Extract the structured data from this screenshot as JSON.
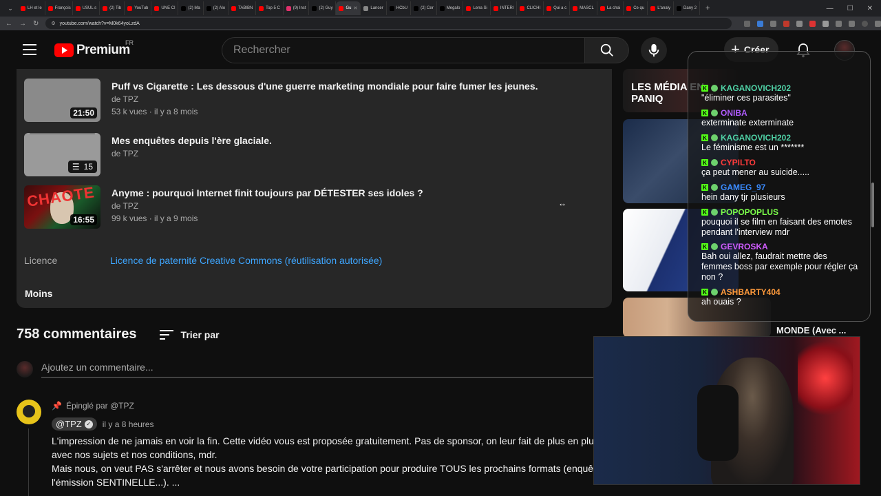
{
  "browser": {
    "tabs": [
      {
        "label": "LH et le",
        "color": "#ff0000"
      },
      {
        "label": "François",
        "color": "#ff0000"
      },
      {
        "label": "USUL s",
        "color": "#ff0000"
      },
      {
        "label": "(2) Tib",
        "color": "#ff0000"
      },
      {
        "label": "YouTub",
        "color": "#ff0000"
      },
      {
        "label": "UNE Cl",
        "color": "#ff0000"
      },
      {
        "label": "(2) Ma",
        "color": "#000000"
      },
      {
        "label": "(2) Alo",
        "color": "#000000"
      },
      {
        "label": "TABIBN",
        "color": "#ff0000"
      },
      {
        "label": "Top 5 C",
        "color": "#ff0000"
      },
      {
        "label": "(9) Inst",
        "color": "#e1306c"
      },
      {
        "label": "(2) Guy",
        "color": "#000000"
      },
      {
        "label": "Gu",
        "color": "#ff0000",
        "active": true
      },
      {
        "label": "Lancer",
        "color": "#888888"
      },
      {
        "label": "HCbU",
        "color": "#000000"
      },
      {
        "label": "(2) Cer",
        "color": "#000000"
      },
      {
        "label": "Megalo",
        "color": "#000000"
      },
      {
        "label": "Lena Si",
        "color": "#ff0000"
      },
      {
        "label": "INTERI",
        "color": "#ff0000"
      },
      {
        "label": "CLICHI",
        "color": "#ff0000"
      },
      {
        "label": "Qui a c",
        "color": "#ff0000"
      },
      {
        "label": "MASCL",
        "color": "#ff0000"
      },
      {
        "label": "La chai",
        "color": "#ff0000"
      },
      {
        "label": "Ce qu",
        "color": "#ff0000"
      },
      {
        "label": "L'analy",
        "color": "#ff0000"
      },
      {
        "label": "Dany 2",
        "color": "#000000"
      }
    ],
    "url": "youtube.com/watch?v=M0k64yoLzdA"
  },
  "header": {
    "logo_text": "Premium",
    "country": "FR",
    "search_placeholder": "Rechercher",
    "create_label": "Créer"
  },
  "description": {
    "videos": [
      {
        "title": "Puff vs Cigarette : Les dessous d'une guerre marketing mondiale pour faire fumer les jeunes.",
        "channel": "de TPZ",
        "stats": "53 k vues · il y a 8 mois",
        "duration": "21:50"
      },
      {
        "title": "Mes enquêtes depuis l'ère glaciale.",
        "channel": "de TPZ",
        "playlist_count": "15"
      },
      {
        "title": "Anyme : pourquoi Internet finit toujours par DÉTESTER ses idoles ?",
        "channel": "de TPZ",
        "stats": "99 k vues · il y a 9 mois",
        "duration": "16:55",
        "thumb_text": "CHAOTE"
      }
    ],
    "licence_label": "Licence",
    "licence_link": "Licence de paternité Creative Commons (réutilisation autorisée)",
    "less_label": "Moins"
  },
  "comments": {
    "count": "758 commentaires",
    "sort_label": "Trier par",
    "add_placeholder": "Ajoutez un commentaire...",
    "pinned": {
      "pinned_by": "Épinglé par @TPZ",
      "author": "@TPZ",
      "time": "il y a 8 heures",
      "lines": [
        "L'impression de ne jamais en voir la fin. Cette vidéo vous est proposée gratuitement. Pas de sponsor, on leur fait de plus en plus p",
        "avec nos sujets et nos conditions, mdr.",
        "Mais nous, on veut PAS s'arrêter et nous avons besoin de votre participation pour produire TOUS les prochains formats (enquêtes",
        "l'émission SENTINELLE...). ..."
      ]
    }
  },
  "suggestions": {
    "first_label": "LES MÉDIA EN PANIQ",
    "last_title": "MONDE (Avec ..."
  },
  "chat": [
    {
      "user": "KAGANOVICH202",
      "color": "#4fd1a5",
      "text": "\"éliminer ces parasites\""
    },
    {
      "user": "ONIBA",
      "color": "#b05cff",
      "text": "exterminate exterminate"
    },
    {
      "user": "KAGANOVICH202",
      "color": "#4fd1a5",
      "text": "Le féminisme est un *******"
    },
    {
      "user": "CYPILTO",
      "color": "#ff3b3b",
      "text": "ça peut mener au suicide....."
    },
    {
      "user": "GAMEG_97",
      "color": "#3a8bff",
      "text": "hein dany tjr plusieurs"
    },
    {
      "user": "POPOPOPLUS",
      "color": "#7cff4a",
      "text": "pouquoi il se film en faisant des emotes pendant l'interview mdr"
    },
    {
      "user": "GEVROSKA",
      "color": "#d05cff",
      "text": "Bah oui allez, faudrait mettre des femmes boss par exemple pour régler ça non ?"
    },
    {
      "user": "ASHBARTY404",
      "color": "#ff9a3b",
      "text": "ah ouais ?"
    }
  ]
}
